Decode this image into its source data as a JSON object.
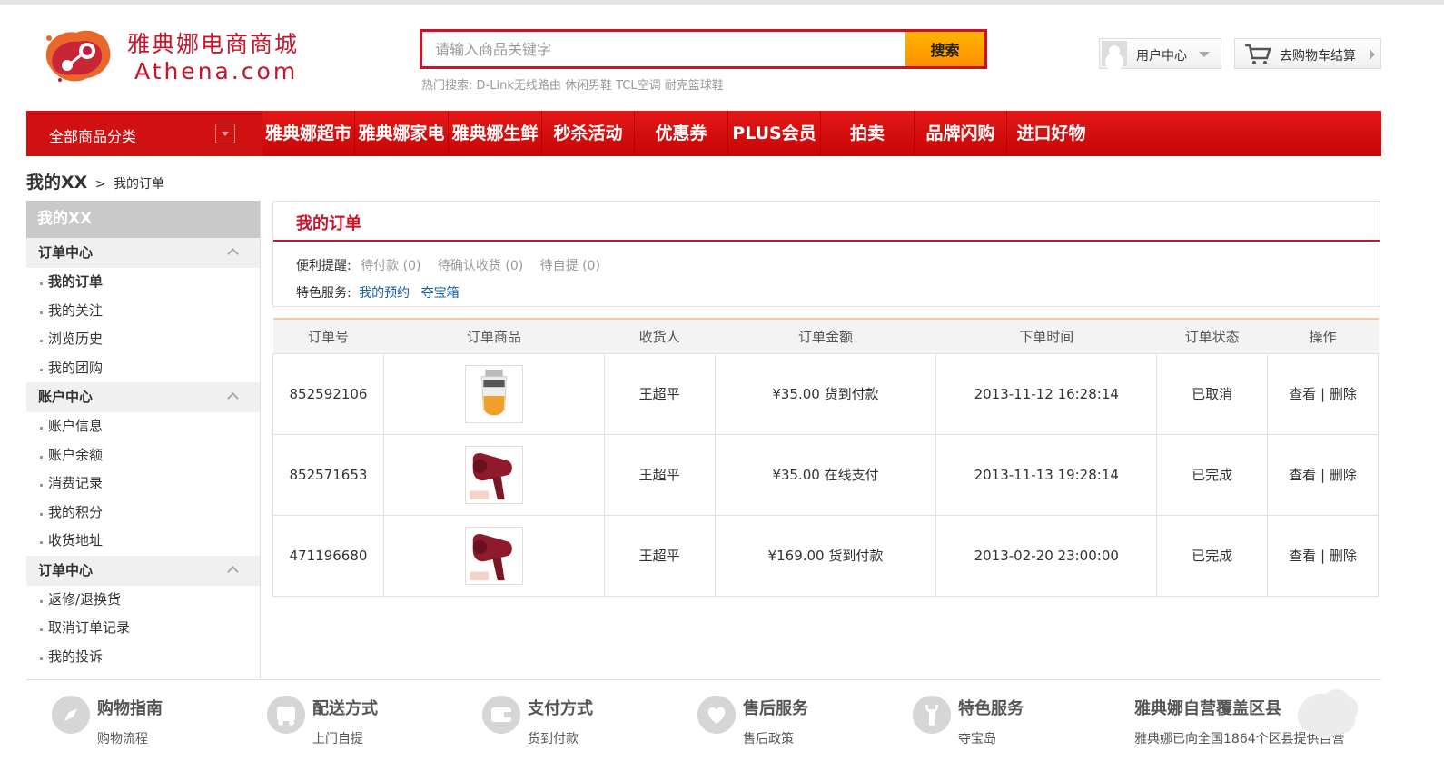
{
  "brand": {
    "name_cn": "雅典娜电商商城",
    "name_en": "Athena.com"
  },
  "search": {
    "placeholder": "请输入商品关键字",
    "button": "搜索",
    "hot_label": "热门搜索:",
    "hot_terms": "D-Link无线路由 休闲男鞋 TCL空调 耐克篮球鞋"
  },
  "header": {
    "user_center": "用户中心",
    "cart": "去购物车结算"
  },
  "nav": {
    "all_label": "全部商品分类",
    "items": [
      "雅典娜超市",
      "雅典娜家电",
      "雅典娜生鲜",
      "秒杀活动",
      "优惠券",
      "PLUS会员",
      "拍卖",
      "品牌闪购",
      "进口好物"
    ]
  },
  "breadcrumb": {
    "root": "我的XX",
    "sep": ">",
    "current": "我的订单"
  },
  "sidebar": {
    "title": "我的XX",
    "sections": [
      {
        "label": "订单中心",
        "items": [
          "我的订单",
          "我的关注",
          "浏览历史",
          "我的团购"
        ]
      },
      {
        "label": "账户中心",
        "items": [
          "账户信息",
          "账户余额",
          "消费记录",
          "我的积分",
          "收货地址"
        ]
      },
      {
        "label": "订单中心",
        "items": [
          "返修/退换货",
          "取消订单记录",
          "我的投诉"
        ]
      }
    ]
  },
  "panel": {
    "title": "我的订单",
    "reminder_label": "便利提醒:",
    "reminders": [
      "待付款 (0)",
      "待确认收货 (0)",
      "待自提 (0)"
    ],
    "services_label": "特色服务:",
    "services": [
      "我的预约",
      "夺宝箱"
    ]
  },
  "table": {
    "headers": [
      "订单号",
      "订单商品",
      "收货人",
      "订单金额",
      "下单时间",
      "订单状态",
      "操作"
    ],
    "rows": [
      {
        "id": "852592106",
        "product_icon": "facial-cleanser-tube",
        "receiver": "王超平",
        "amount": "¥35.00 货到付款",
        "time": "2013-11-12 16:28:14",
        "status": "已取消",
        "view": "查看",
        "sep": "|",
        "delete": "删除"
      },
      {
        "id": "852571653",
        "product_icon": "hair-dryer",
        "receiver": "王超平",
        "amount": "¥35.00 在线支付",
        "time": "2013-11-13 19:28:14",
        "status": "已完成",
        "view": "查看",
        "sep": "|",
        "delete": "删除"
      },
      {
        "id": "471196680",
        "product_icon": "hair-dryer",
        "receiver": "王超平",
        "amount": "¥169.00 货到付款",
        "time": "2013-02-20 23:00:00",
        "status": "已完成",
        "view": "查看",
        "sep": "|",
        "delete": "删除"
      }
    ]
  },
  "footer": [
    {
      "icon": "compass-icon",
      "title": "购物指南",
      "sub": "购物流程"
    },
    {
      "icon": "delivery-truck-icon",
      "title": "配送方式",
      "sub": "上门自提"
    },
    {
      "icon": "wallet-icon",
      "title": "支付方式",
      "sub": "货到付款"
    },
    {
      "icon": "heart-icon",
      "title": "售后服务",
      "sub": "售后政策"
    },
    {
      "icon": "wrench-icon",
      "title": "特色服务",
      "sub": "夺宝岛"
    },
    {
      "icon": "china-map-icon",
      "title": "雅典娜自营覆盖区县",
      "sub": "雅典娜已向全国1864个区县提供自营"
    }
  ],
  "colors": {
    "accent": "#c9132a",
    "nav_red": "#d81010",
    "search_btn": "#ff9f00",
    "link_blue": "#1a5ea8"
  }
}
